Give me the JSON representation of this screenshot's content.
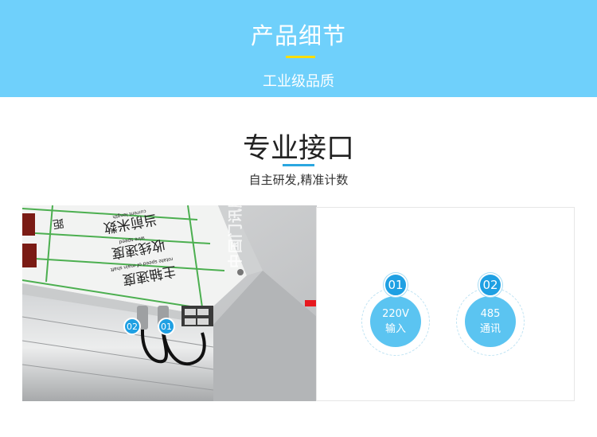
{
  "banner": {
    "title": "产品细节",
    "subtitle": "工业级品质",
    "color": "#6fd0fb",
    "accent": "#ffdd00"
  },
  "section": {
    "title": "专业接口",
    "subtitle": "自主研发,精准计数",
    "accent": "#2aa7e0"
  },
  "photo": {
    "labels": {
      "row1": "当前米数",
      "row1_en": "current length",
      "row2": "收线速度",
      "row2_en": "wire speed",
      "row3": "主轴速度",
      "row3_en": "rotate speed of main shaft",
      "row0": "距"
    },
    "port_badges": [
      "02",
      "01"
    ],
    "watermark": "中国门讯鹏"
  },
  "arrow_icon": "right-arrow-icon",
  "interfaces": [
    {
      "number": "01",
      "line1": "220V",
      "line2": "输入"
    },
    {
      "number": "02",
      "line1": "485",
      "line2": "通讯"
    }
  ]
}
